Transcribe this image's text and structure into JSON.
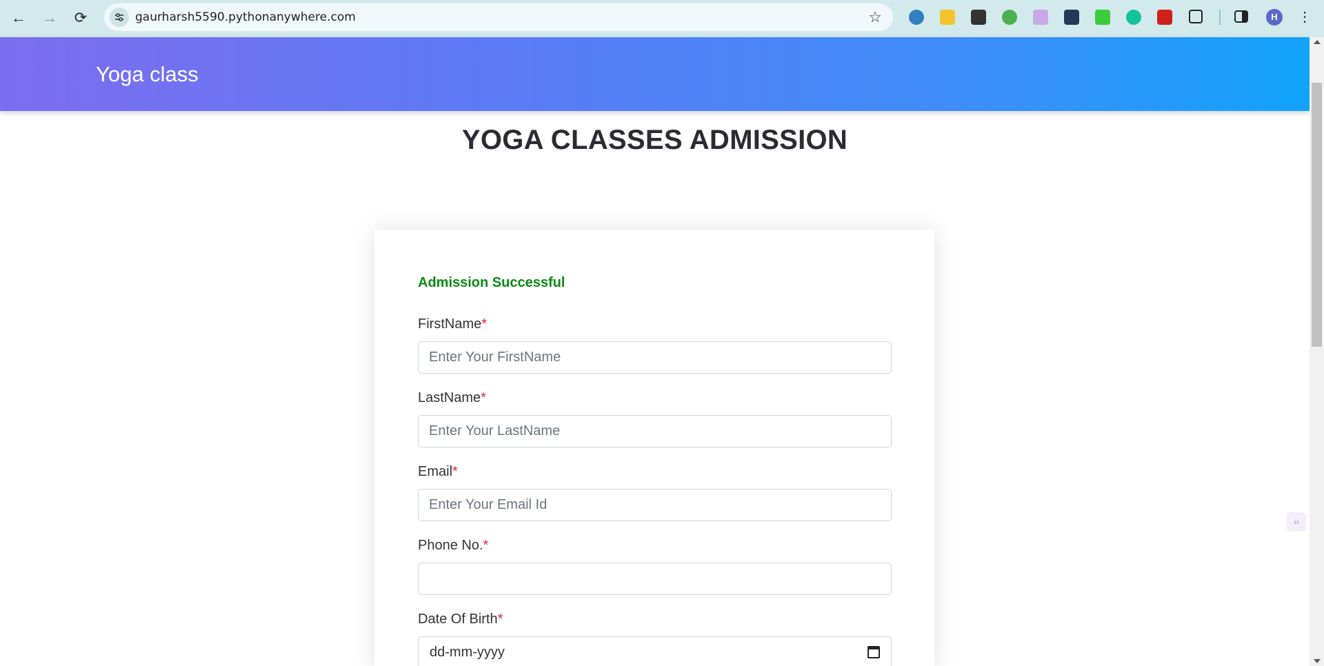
{
  "browser": {
    "url": "gaurharsh5590.pythonanywhere.com",
    "back_icon": "←",
    "forward_icon": "→",
    "reload_icon": "⟳",
    "star_icon": "☆",
    "profile_initial": "H",
    "menu_icon": "⋮",
    "extensions": [
      {
        "name": "ext-blue-icon",
        "color": "#2f7fc1"
      },
      {
        "name": "ext-notes-icon",
        "color": "#f4c430"
      },
      {
        "name": "ext-search-icon",
        "color": "#333333"
      },
      {
        "name": "ext-robot-icon",
        "color": "#4caf50"
      },
      {
        "name": "ext-purple-icon",
        "color": "#c9a8e6"
      },
      {
        "name": "ext-dark-icon",
        "color": "#1f3a5a"
      },
      {
        "name": "ext-lock-icon",
        "color": "#3bcc3b"
      },
      {
        "name": "ext-grammarly-icon",
        "color": "#15c39a"
      },
      {
        "name": "ext-pdf-icon",
        "color": "#d0201b"
      }
    ]
  },
  "navbar": {
    "brand": "Yoga class"
  },
  "page": {
    "heading": "YOGA CLASSES ADMISSION"
  },
  "form": {
    "status": "Admission Successful",
    "required_mark": "*",
    "fields": {
      "firstname": {
        "label": "FirstName",
        "placeholder": "Enter Your FirstName"
      },
      "lastname": {
        "label": "LastName",
        "placeholder": "Enter Your LastName"
      },
      "email": {
        "label": "Email",
        "placeholder": "Enter Your Email Id"
      },
      "phone": {
        "label": "Phone No.",
        "placeholder": ""
      },
      "dob": {
        "label": "Date Of Birth",
        "value": "dd-mm-yyyy"
      }
    }
  },
  "side_widget": {
    "text": "›‹"
  }
}
